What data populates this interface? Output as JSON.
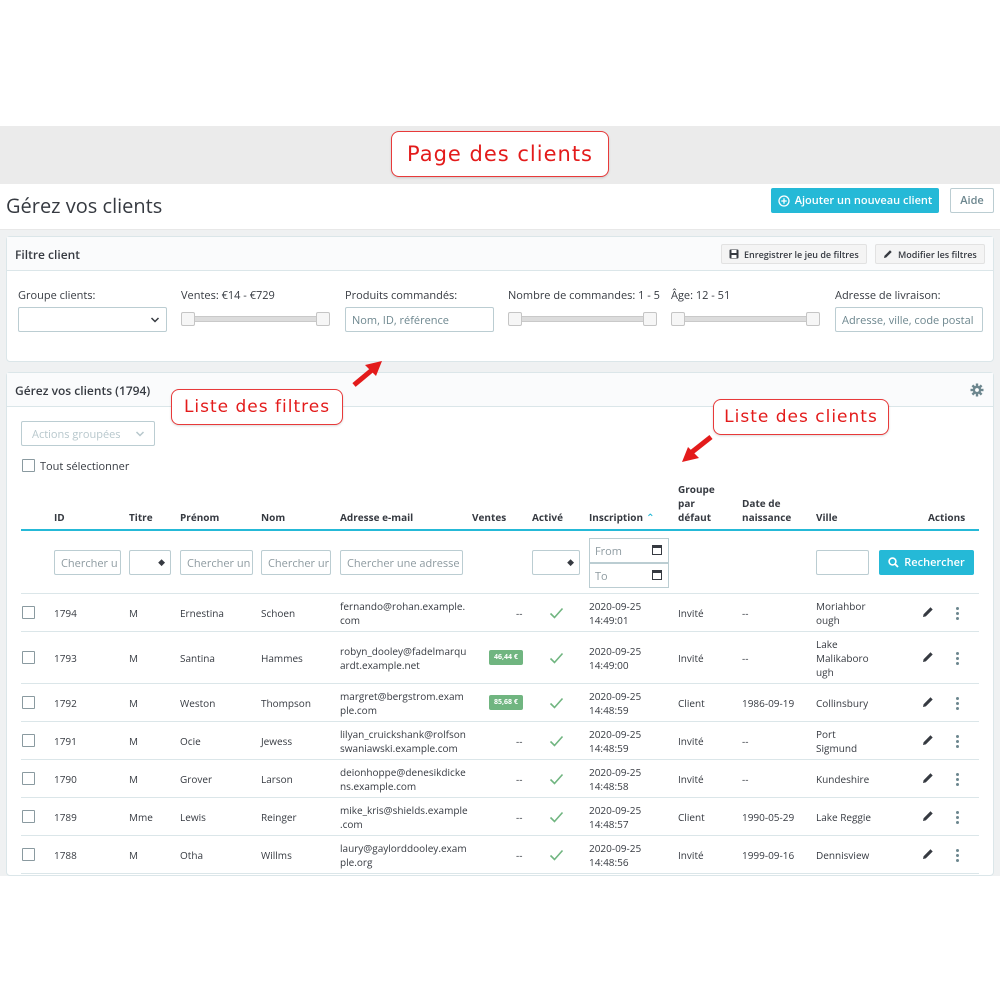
{
  "callouts": {
    "page": "Page des clients",
    "filters": "Liste des filtres",
    "clients": "Liste des clients"
  },
  "header": {
    "title": "Gérez vos clients",
    "add_button": "Ajouter un nouveau client",
    "help_button": "Aide"
  },
  "filter_panel": {
    "title": "Filtre client",
    "save_button": "Enregistrer le jeu de filtres",
    "edit_button": "Modifier les filtres",
    "group_label": "Groupe clients:",
    "sales_label": "Ventes: €14 - €729",
    "products_label": "Produits commandés:",
    "products_placeholder": "Nom, ID, référence",
    "orders_label": "Nombre de commandes: 1 - 5",
    "age_label": "Âge: 12 - 51",
    "address_label": "Adresse de livraison:",
    "address_placeholder": "Adresse, ville, code postal"
  },
  "list": {
    "title": "Gérez vos clients (1794)",
    "bulk_actions": "Actions groupées",
    "select_all": "Tout sélectionner",
    "columns": {
      "id": "ID",
      "title": "Titre",
      "firstname": "Prénom",
      "lastname": "Nom",
      "email": "Adresse e-mail",
      "sales": "Ventes",
      "active": "Activé",
      "registration": "Inscription",
      "group_l1": "Groupe",
      "group_l2": "par",
      "group_l3": "défaut",
      "birth_l1": "Date de",
      "birth_l2": "naissance",
      "city": "Ville",
      "actions": "Actions"
    },
    "search": {
      "id_ph": "Chercher u",
      "firstname_ph": "Chercher un",
      "lastname_ph": "Chercher ur",
      "email_ph": "Chercher une adresse e",
      "date_from": "From",
      "date_to": "To",
      "button": "Rechercher"
    },
    "rows": [
      {
        "id": "1794",
        "title": "M",
        "firstname": "Ernestina",
        "lastname": "Schoen",
        "email1": "fernando@rohan.example.",
        "email2": "com",
        "sales": "--",
        "date": "2020-09-25",
        "time": "14:49:01",
        "group": "Invité",
        "birth": "--",
        "city1": "Moriahbor",
        "city2": "ough",
        "city3": ""
      },
      {
        "id": "1793",
        "title": "M",
        "firstname": "Santina",
        "lastname": "Hammes",
        "email1": "robyn_dooley@fadelmarqu",
        "email2": "ardt.example.net",
        "sales": "46,44 €",
        "date": "2020-09-25",
        "time": "14:49:00",
        "group": "Invité",
        "birth": "--",
        "city1": "Lake",
        "city2": "Malikaboro",
        "city3": "ugh"
      },
      {
        "id": "1792",
        "title": "M",
        "firstname": "Weston",
        "lastname": "Thompson",
        "email1": "margret@bergstrom.exam",
        "email2": "ple.com",
        "sales": "85,68 €",
        "date": "2020-09-25",
        "time": "14:48:59",
        "group": "Client",
        "birth": "1986-09-19",
        "city1": "Collinsbury",
        "city2": "",
        "city3": ""
      },
      {
        "id": "1791",
        "title": "M",
        "firstname": "Ocie",
        "lastname": "Jewess",
        "email1": "lilyan_cruickshank@rolfson",
        "email2": "swaniawski.example.com",
        "sales": "--",
        "date": "2020-09-25",
        "time": "14:48:59",
        "group": "Invité",
        "birth": "--",
        "city1": "Port",
        "city2": "Sigmund",
        "city3": ""
      },
      {
        "id": "1790",
        "title": "M",
        "firstname": "Grover",
        "lastname": "Larson",
        "email1": "deionhoppe@denesikdicke",
        "email2": "ns.example.com",
        "sales": "--",
        "date": "2020-09-25",
        "time": "14:48:58",
        "group": "Invité",
        "birth": "--",
        "city1": "Kundeshire",
        "city2": "",
        "city3": ""
      },
      {
        "id": "1789",
        "title": "Mme",
        "firstname": "Lewis",
        "lastname": "Reinger",
        "email1": "mike_kris@shields.example",
        "email2": ".com",
        "sales": "--",
        "date": "2020-09-25",
        "time": "14:48:57",
        "group": "Client",
        "birth": "1990-05-29",
        "city1": "Lake Reggie",
        "city2": "",
        "city3": ""
      },
      {
        "id": "1788",
        "title": "M",
        "firstname": "Otha",
        "lastname": "Willms",
        "email1": "laury@gaylorddooley.exam",
        "email2": "ple.org",
        "sales": "--",
        "date": "2020-09-25",
        "time": "14:48:56",
        "group": "Invité",
        "birth": "1999-09-16",
        "city1": "Dennisview",
        "city2": "",
        "city3": ""
      }
    ]
  },
  "colors": {
    "accent": "#25b9d7",
    "badge": "#70b580",
    "callout_red": "#e31b1b"
  }
}
